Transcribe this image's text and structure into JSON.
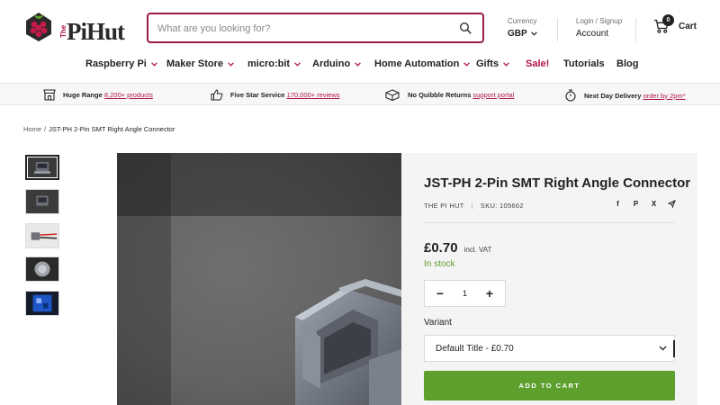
{
  "header": {
    "logo_text": "PiHut",
    "logo_prefix": "The",
    "search_placeholder": "What are you looking for?",
    "currency": {
      "label": "Currency",
      "value": "GBP"
    },
    "account": {
      "label": "Login / Signup",
      "value": "Account"
    },
    "cart": {
      "count": "0",
      "label": "Cart"
    }
  },
  "nav": [
    {
      "label": "Raspberry Pi",
      "dropdown": true
    },
    {
      "label": "Maker Store",
      "dropdown": true
    },
    {
      "label": "micro:bit",
      "dropdown": true
    },
    {
      "label": "Arduino",
      "dropdown": true
    },
    {
      "label": "Home Automation",
      "dropdown": true
    },
    {
      "label": "Gifts",
      "dropdown": true
    },
    {
      "label": "Sale!",
      "dropdown": false
    },
    {
      "label": "Tutorials",
      "dropdown": false
    },
    {
      "label": "Blog",
      "dropdown": false
    }
  ],
  "benefits": [
    {
      "title": "Huge Range",
      "link": "8,200+ products",
      "icon": "shop-icon"
    },
    {
      "title": "Five Star Service",
      "link": "170,000+ reviews",
      "icon": "thumbs-up-icon"
    },
    {
      "title": "No Quibble Returns",
      "link": "support portal",
      "icon": "box-icon"
    },
    {
      "title": "Next Day Delivery",
      "link": "order by 2pm*",
      "icon": "stopwatch-icon"
    }
  ],
  "breadcrumb": {
    "home": "Home",
    "separator": "/",
    "current": "JST-PH 2-Pin SMT Right Angle Connector"
  },
  "product": {
    "title": "JST-PH 2-Pin SMT Right Angle Connector",
    "vendor": "The Pi Hut",
    "sku": "SKU: 105662",
    "price": "£0.70",
    "tax_note": "incl. VAT",
    "stock": "In stock",
    "quantity": "1",
    "variant_label": "Variant",
    "variant_value": "Default Title - £0.70",
    "add_to_cart": "ADD TO CART",
    "share": {
      "facebook": "f",
      "pinterest": "P",
      "twitter": "X"
    }
  },
  "colors": {
    "brand": "#b0164c",
    "search_border": "#9b1b42",
    "add_to_cart": "#5ea02e",
    "in_stock": "#5ea02e",
    "panel_bg": "#f4f4f4"
  }
}
